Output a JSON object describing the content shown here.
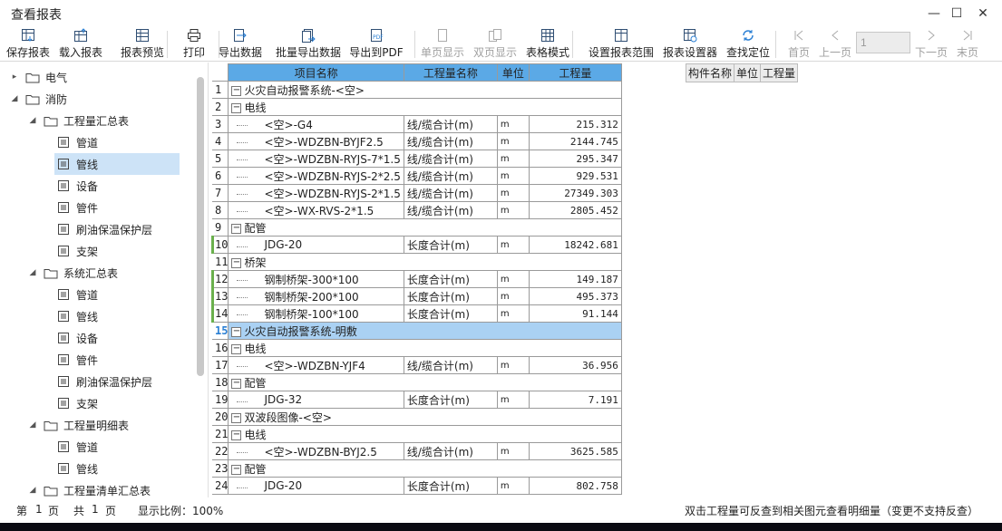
{
  "window": {
    "title": "查看报表",
    "controls": [
      "—",
      "☐",
      "✕"
    ]
  },
  "toolbar": {
    "buttons": [
      {
        "label": "保存报表",
        "icon": "save-table-icon",
        "enabled": true
      },
      {
        "label": "载入报表",
        "icon": "load-table-icon",
        "enabled": true
      },
      {
        "label": "报表预览",
        "icon": "preview-table-icon",
        "enabled": true
      },
      {
        "label": "打印",
        "icon": "printer-icon",
        "enabled": true
      },
      {
        "label": "导出数据",
        "icon": "export-data-icon",
        "enabled": true
      },
      {
        "label": "批量导出数据",
        "icon": "batch-export-icon",
        "enabled": true
      },
      {
        "label": "导出到PDF",
        "icon": "pdf-export-icon",
        "enabled": true
      },
      {
        "label": "单页显示",
        "icon": "single-page-icon",
        "enabled": false
      },
      {
        "label": "双页显示",
        "icon": "double-page-icon",
        "enabled": false
      },
      {
        "label": "表格模式",
        "icon": "table-mode-icon",
        "enabled": true
      },
      {
        "label": "设置报表范围",
        "icon": "report-range-icon",
        "enabled": true
      },
      {
        "label": "报表设置器",
        "icon": "report-settings-icon",
        "enabled": true
      },
      {
        "label": "查找定位",
        "icon": "find-locate-icon",
        "enabled": true
      },
      {
        "label": "首页",
        "icon": "first-page-icon",
        "enabled": false
      },
      {
        "label": "上一页",
        "icon": "prev-page-icon",
        "enabled": false
      },
      {
        "label": "下一页",
        "icon": "next-page-icon",
        "enabled": false
      },
      {
        "label": "末页",
        "icon": "last-page-icon",
        "enabled": false
      }
    ],
    "page_input_value": "1"
  },
  "tree": [
    {
      "label": "电气",
      "type": "folder",
      "level": 0,
      "expanded": false
    },
    {
      "label": "消防",
      "type": "folder",
      "level": 0,
      "expanded": true
    },
    {
      "label": "工程量汇总表",
      "type": "folder",
      "level": 1,
      "expanded": true
    },
    {
      "label": "管道",
      "type": "doc",
      "level": 2
    },
    {
      "label": "管线",
      "type": "doc",
      "level": 2,
      "selected": true
    },
    {
      "label": "设备",
      "type": "doc",
      "level": 2
    },
    {
      "label": "管件",
      "type": "doc",
      "level": 2
    },
    {
      "label": "刷油保温保护层",
      "type": "doc",
      "level": 2
    },
    {
      "label": "支架",
      "type": "doc",
      "level": 2
    },
    {
      "label": "系统汇总表",
      "type": "folder",
      "level": 1,
      "expanded": true
    },
    {
      "label": "管道",
      "type": "doc",
      "level": 2
    },
    {
      "label": "管线",
      "type": "doc",
      "level": 2
    },
    {
      "label": "设备",
      "type": "doc",
      "level": 2
    },
    {
      "label": "管件",
      "type": "doc",
      "level": 2
    },
    {
      "label": "刷油保温保护层",
      "type": "doc",
      "level": 2
    },
    {
      "label": "支架",
      "type": "doc",
      "level": 2
    },
    {
      "label": "工程量明细表",
      "type": "folder",
      "level": 1,
      "expanded": true
    },
    {
      "label": "管道",
      "type": "doc",
      "level": 2
    },
    {
      "label": "管线",
      "type": "doc",
      "level": 2
    },
    {
      "label": "工程量清单汇总表",
      "type": "folder",
      "level": 1,
      "expanded": true
    }
  ],
  "grid": {
    "headers": [
      "项目名称",
      "工程量名称",
      "单位",
      "工程量"
    ],
    "rows": [
      {
        "n": "1",
        "kind": "group1",
        "name": "火灾自动报警系统-<空>"
      },
      {
        "n": "2",
        "kind": "group2",
        "name": "电线"
      },
      {
        "n": "3",
        "kind": "leaf",
        "name": "<空>-G4",
        "measure": "线/缆合计(m)",
        "unit": "m",
        "qty": "215.312"
      },
      {
        "n": "4",
        "kind": "leaf",
        "name": "<空>-WDZBN-BYJF2.5",
        "measure": "线/缆合计(m)",
        "unit": "m",
        "qty": "2144.745"
      },
      {
        "n": "5",
        "kind": "leaf",
        "name": "<空>-WDZBN-RYJS-7*1.5",
        "measure": "线/缆合计(m)",
        "unit": "m",
        "qty": "295.347"
      },
      {
        "n": "6",
        "kind": "leaf",
        "name": "<空>-WDZBN-RYJS-2*2.5",
        "measure": "线/缆合计(m)",
        "unit": "m",
        "qty": "929.531"
      },
      {
        "n": "7",
        "kind": "leaf",
        "name": "<空>-WDZBN-RYJS-2*1.5",
        "measure": "线/缆合计(m)",
        "unit": "m",
        "qty": "27349.303"
      },
      {
        "n": "8",
        "kind": "leaf",
        "name": "<空>-WX-RVS-2*1.5",
        "measure": "线/缆合计(m)",
        "unit": "m",
        "qty": "2805.452"
      },
      {
        "n": "9",
        "kind": "group2",
        "name": "配管"
      },
      {
        "n": "10",
        "kind": "leaf",
        "name": "JDG-20",
        "measure": "长度合计(m)",
        "unit": "m",
        "qty": "18242.681"
      },
      {
        "n": "11",
        "kind": "group2",
        "name": "桥架"
      },
      {
        "n": "12",
        "kind": "leaf",
        "name": "钢制桥架-300*100",
        "measure": "长度合计(m)",
        "unit": "m",
        "qty": "149.187"
      },
      {
        "n": "13",
        "kind": "leaf",
        "name": "钢制桥架-200*100",
        "measure": "长度合计(m)",
        "unit": "m",
        "qty": "495.373"
      },
      {
        "n": "14",
        "kind": "leaf",
        "name": "钢制桥架-100*100",
        "measure": "长度合计(m)",
        "unit": "m",
        "qty": "91.144"
      },
      {
        "n": "15",
        "kind": "group1",
        "name": "火灾自动报警系统-明敷",
        "selected": true
      },
      {
        "n": "16",
        "kind": "group2",
        "name": "电线"
      },
      {
        "n": "17",
        "kind": "leaf",
        "name": "<空>-WDZBN-YJF4",
        "measure": "线/缆合计(m)",
        "unit": "m",
        "qty": "36.956"
      },
      {
        "n": "18",
        "kind": "group2",
        "name": "配管"
      },
      {
        "n": "19",
        "kind": "leaf",
        "name": "JDG-32",
        "measure": "长度合计(m)",
        "unit": "m",
        "qty": "7.191"
      },
      {
        "n": "20",
        "kind": "group1",
        "name": "双波段图像-<空>"
      },
      {
        "n": "21",
        "kind": "group2",
        "name": "电线"
      },
      {
        "n": "22",
        "kind": "leaf",
        "name": "<空>-WDZBN-BYJ2.5",
        "measure": "线/缆合计(m)",
        "unit": "m",
        "qty": "3625.585"
      },
      {
        "n": "23",
        "kind": "group2",
        "name": "配管"
      },
      {
        "n": "24",
        "kind": "leaf",
        "name": "JDG-20",
        "measure": "长度合计(m)",
        "unit": "m",
        "qty": "802.758"
      }
    ]
  },
  "detail_headers": [
    "构件名称",
    "单位",
    "工程量"
  ],
  "status": {
    "page_prefix": "第",
    "page_no": "1",
    "page_unit": "页",
    "total_prefix": "共",
    "total_no": "1",
    "total_unit": "页",
    "zoom": "显示比例：100%",
    "hint": "双击工程量可反查到相关图元查看明细量（变更不支持反查）"
  },
  "colors": {
    "header_blue": "#5ba9e6",
    "selected_row": "#aad1f3",
    "tree_selected": "#cde3f7"
  }
}
